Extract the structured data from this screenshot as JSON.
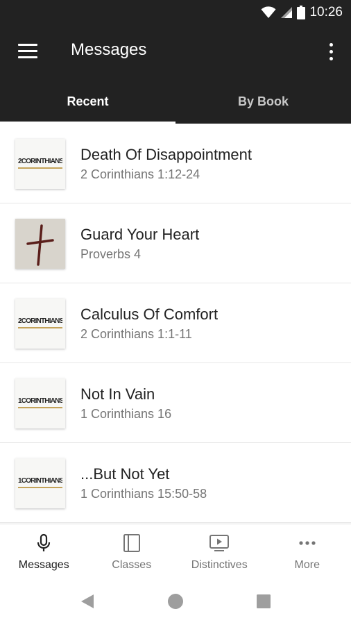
{
  "status_bar": {
    "time": "10:26",
    "icons": [
      "wifi-icon",
      "signal-icon",
      "battery-icon"
    ]
  },
  "app_bar": {
    "title": "Messages",
    "menu_icon": "hamburger-menu-icon",
    "overflow_icon": "more-vertical-icon"
  },
  "tabs": [
    {
      "label": "Recent",
      "active": true
    },
    {
      "label": "By Book",
      "active": false
    }
  ],
  "messages": [
    {
      "title": "Death Of Disappointment",
      "reference": "2 Corinthians 1:12-24",
      "thumb_text": "2CORINTHIANS"
    },
    {
      "title": "Guard Your Heart",
      "reference": "Proverbs 4",
      "thumb_text": ""
    },
    {
      "title": "Calculus Of Comfort",
      "reference": "2 Corinthians 1:1-11",
      "thumb_text": "2CORINTHIANS"
    },
    {
      "title": "Not In Vain",
      "reference": "1 Corinthians 16",
      "thumb_text": "1CORINTHIANS"
    },
    {
      "title": "...But Not Yet",
      "reference": "1 Corinthians 15:50-58",
      "thumb_text": "1CORINTHIANS"
    }
  ],
  "bottom_nav": [
    {
      "label": "Messages",
      "icon": "microphone-icon",
      "active": true
    },
    {
      "label": "Classes",
      "icon": "book-icon",
      "active": false
    },
    {
      "label": "Distinctives",
      "icon": "video-play-icon",
      "active": false
    },
    {
      "label": "More",
      "icon": "more-horizontal-icon",
      "active": false
    }
  ],
  "system_nav": [
    "back-icon",
    "home-icon",
    "recents-icon"
  ],
  "colors": {
    "app_bar": "#222222",
    "accent_gold": "#c4a35a",
    "text_primary": "#212121",
    "text_secondary": "#757575"
  }
}
